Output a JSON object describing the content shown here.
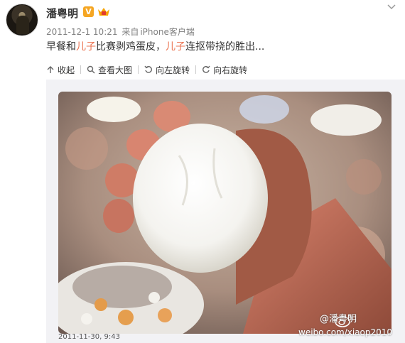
{
  "user": {
    "name": "潘粤明",
    "verified_badge": "V",
    "badge_color": "#f5a623"
  },
  "meta": {
    "time": "2011-12-1 10:21",
    "source_prefix": "来自",
    "client": "iPhone客户端"
  },
  "post": {
    "segments": [
      {
        "text": "早餐和",
        "highlight": false
      },
      {
        "text": "儿子",
        "highlight": true
      },
      {
        "text": "比赛剥鸡蛋皮，",
        "highlight": false
      },
      {
        "text": "儿子",
        "highlight": true
      },
      {
        "text": "连抠带挠的胜出...",
        "highlight": false
      }
    ],
    "highlight_color": "#eb7350"
  },
  "toolbar": {
    "collapse": "收起",
    "view_large": "查看大图",
    "rotate_left": "向左旋转",
    "rotate_right": "向右旋转"
  },
  "image": {
    "date_stamp": "2011-11-30, 9:43",
    "watermark_name": "@潘粤明",
    "watermark_url": "weibo.com/xiaop2010"
  }
}
